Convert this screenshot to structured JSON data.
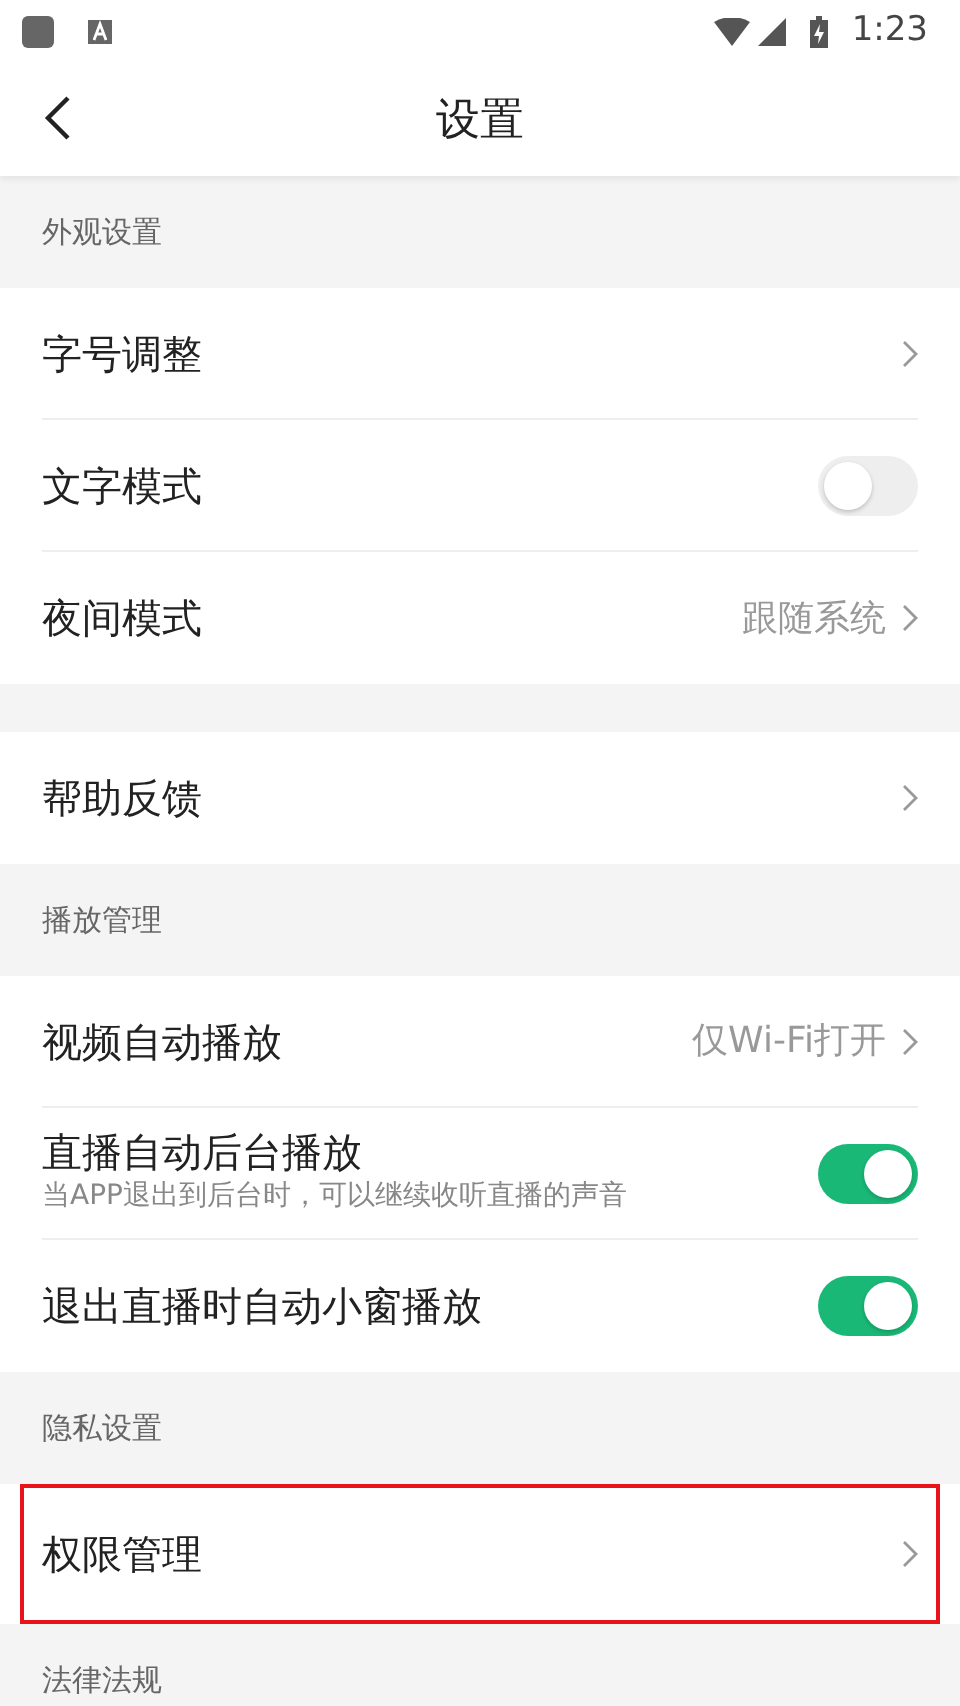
{
  "status_bar": {
    "time": "1:23"
  },
  "header": {
    "title": "设置"
  },
  "groups": [
    {
      "title": "外观设置",
      "items": [
        {
          "kind": "link",
          "label": "字号调整",
          "highlighted": false
        },
        {
          "kind": "toggle",
          "label": "文字模式",
          "on": false,
          "highlighted": false
        },
        {
          "kind": "link",
          "label": "夜间模式",
          "value": "跟随系统",
          "highlighted": false
        }
      ]
    },
    {
      "items": [
        {
          "kind": "link",
          "label": "帮助反馈",
          "highlighted": false
        }
      ]
    },
    {
      "title": "播放管理",
      "items": [
        {
          "kind": "link",
          "label": "视频自动播放",
          "value": "仅Wi-Fi打开",
          "highlighted": false
        },
        {
          "kind": "toggle",
          "label": "直播自动后台播放",
          "subtitle": "当APP退出到后台时，可以继续收听直播的声音",
          "on": true,
          "highlighted": false
        },
        {
          "kind": "toggle",
          "label": "退出直播时自动小窗播放",
          "on": true,
          "highlighted": false
        }
      ]
    },
    {
      "title": "隐私设置",
      "items": [
        {
          "kind": "link",
          "label": "权限管理",
          "highlighted": true
        }
      ]
    },
    {
      "title": "法律法规"
    }
  ]
}
